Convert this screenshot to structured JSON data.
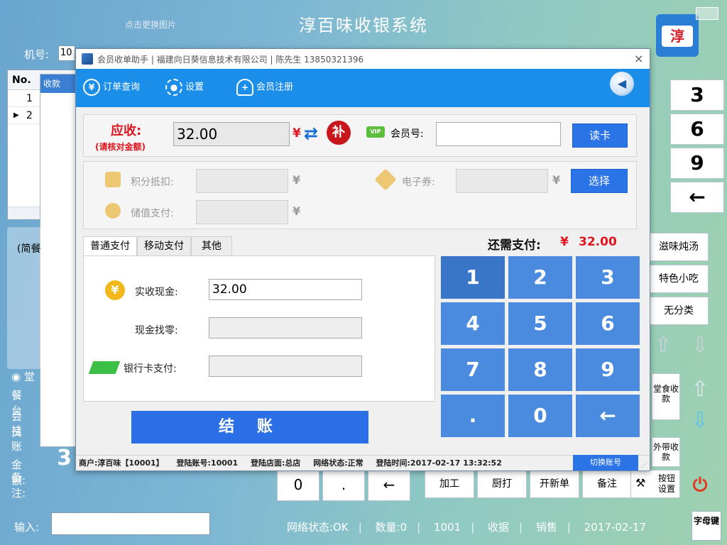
{
  "app": {
    "title": "淳百味收银系统",
    "hint": "点击更换图片",
    "logo_text": "淳",
    "machine_label": "机号:",
    "machine_value": "10"
  },
  "order_table": {
    "header": "No.",
    "rows": [
      {
        "no": "1",
        "marker": ""
      },
      {
        "no": "2",
        "marker": "▶"
      }
    ]
  },
  "receive_panel": {
    "title": "收款"
  },
  "left_info": {
    "dine_in": "堂",
    "table_label": "餐台",
    "member_label": "会员",
    "hang_label": "挂账",
    "amount_label": "金额:",
    "remark_label": "备注:",
    "amount_big": "3",
    "category_partial": "(简餐"
  },
  "right_keypad": [
    "3",
    "6",
    "9",
    "←"
  ],
  "categories": [
    "滋味炖汤",
    "特色小吃",
    "无分类"
  ],
  "side_buttons": {
    "dine_in_pay": "堂食收款",
    "takeout_pay": "外带收款",
    "key_settings": "按钮设置"
  },
  "bottom_keys": [
    "0",
    ".",
    "←"
  ],
  "func_keys": [
    "加工",
    "厨打",
    "开新单",
    "备注"
  ],
  "input": {
    "label": "输入:"
  },
  "status": {
    "network": "网络状态:OK",
    "quantity": "数量:0",
    "account": "1001",
    "cashier": "收据",
    "mode": "销售",
    "date": "2017-02-17"
  },
  "letter_key": "字母键",
  "dialog": {
    "title": "会员收单助手 | 福建向日葵信息技术有限公司 | 陈先生 13850321396",
    "close": "×",
    "toolbar": {
      "order_query": "订单查询",
      "settings": "设置",
      "member_register": "会员注册"
    },
    "due": {
      "label": "应收:",
      "sub": "(请核对金额)",
      "value": "32.00",
      "currency": "¥",
      "fill_label": "补"
    },
    "member": {
      "vip": "VIP",
      "label": "会员号:",
      "value": "",
      "read_card": "读卡"
    },
    "points": {
      "label": "积分抵扣:",
      "currency": "¥"
    },
    "stored_value": {
      "label": "储值支付:",
      "currency": "¥"
    },
    "coupon": {
      "label": "电子券:",
      "currency": "¥",
      "select": "选择"
    },
    "tabs": [
      "普通支付",
      "移动支付",
      "其他"
    ],
    "remaining": {
      "label": "还需支付:",
      "currency": "¥",
      "value": "32.00"
    },
    "payment": {
      "cash_label": "实收现金:",
      "cash_value": "32.00",
      "change_label": "现金找零:",
      "change_value": "",
      "card_label": "银行卡支付:",
      "card_value": ""
    },
    "numpad": [
      "1",
      "2",
      "3",
      "4",
      "5",
      "6",
      "7",
      "8",
      "9",
      ".",
      "0",
      "←"
    ],
    "checkout": "结 账",
    "statusbar": {
      "merchant": "商户:淳百味【10001】",
      "login_account": "登陆账号:10001",
      "login_store": "登陆店面:总店",
      "network": "网络状态:正常",
      "login_time": "登陆时间:2017-02-17 13:32:52",
      "switch_account": "切换账号"
    }
  }
}
